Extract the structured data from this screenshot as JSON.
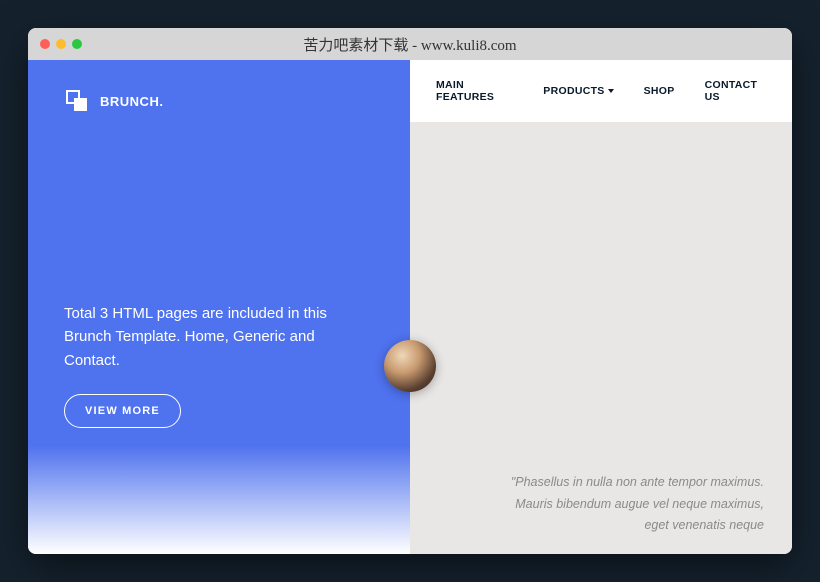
{
  "window": {
    "title": "苦力吧素材下载 - www.kuli8.com"
  },
  "brand": {
    "name": "BRUNCH."
  },
  "nav": {
    "items": [
      {
        "label": "MAIN FEATURES",
        "dropdown": false
      },
      {
        "label": "PRODUCTS",
        "dropdown": true
      },
      {
        "label": "SHOP",
        "dropdown": false
      },
      {
        "label": "CONTACT US",
        "dropdown": false
      }
    ]
  },
  "hero": {
    "text": "Total 3 HTML pages are included in this Brunch Template. Home, Generic and Contact.",
    "button": "VIEW MORE"
  },
  "testimonial": {
    "quote": "\"Phasellus in nulla non ante tempor maximus. Mauris bibendum augue vel neque maximus, eget venenatis neque"
  }
}
